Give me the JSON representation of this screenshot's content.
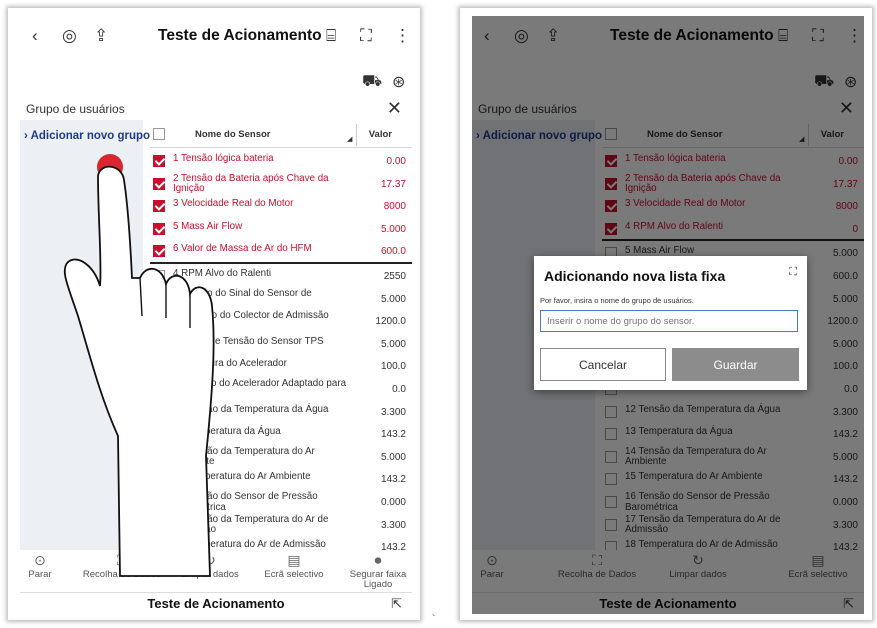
{
  "app": {
    "title": "Teste de Acionamento",
    "footer_title": "Teste de Acionamento"
  },
  "icons": {
    "back": "‹",
    "diag": "◎",
    "upload": "⇪",
    "vci": "⌸",
    "fullscreen": "⛶",
    "more": "⋮",
    "car": "⛟",
    "tool": "⊛",
    "close": "✕",
    "stop": "⊙",
    "capture": "⛶",
    "clear": "↻",
    "screen": "▤",
    "record": "⏺",
    "pin": "⇱"
  },
  "panel": {
    "group_label": "Grupo de usuários",
    "add_group": "› Adicionar novo grupo"
  },
  "table": {
    "col_name": "Nome do Sensor",
    "col_value": "Valor"
  },
  "rows_left": [
    {
      "name": "1 Tensão lógica bateria",
      "value": "0.00",
      "checked": true
    },
    {
      "name": "2 Tensão da Bateria após Chave da Ignição",
      "value": "17.37",
      "checked": true
    },
    {
      "name": "3 Velocidade Real do Motor",
      "value": "8000",
      "checked": true
    },
    {
      "name": "5 Mass Air Flow",
      "value": "5.000",
      "checked": true
    },
    {
      "name": "6 Valor de Massa de Ar do HFM",
      "value": "600.0",
      "checked": true
    },
    {
      "name": "4 RPM Alvo do Ralenti",
      "value": "2550",
      "checked": false
    },
    {
      "name": "7 Tensão do Sinal do Sensor de Pressão",
      "value": "5.000",
      "checked": false
    },
    {
      "name": "8 Pressão do Colector de Admissão",
      "value": "1200.0",
      "checked": false
    },
    {
      "name": "9 Saída de Tensão do Sensor TPS",
      "value": "5.000",
      "checked": false
    },
    {
      "name": "10 Abertura do Acelerador",
      "value": "100.0",
      "checked": false
    },
    {
      "name": "11 Ângulo do Acelerador Adaptado para Ralenti",
      "value": "0.0",
      "checked": false
    },
    {
      "name": "12 Tensão da Temperatura da Água",
      "value": "3.300",
      "checked": false
    },
    {
      "name": "13 Temperatura da Água",
      "value": "143.2",
      "checked": false
    },
    {
      "name": "14 Tensão da Temperatura do Ar Ambiente",
      "value": "5.000",
      "checked": false
    },
    {
      "name": "15 Temperatura do Ar Ambiente",
      "value": "143.2",
      "checked": false
    },
    {
      "name": "16 Tensão do Sensor de Pressão Barométrica",
      "value": "0.000",
      "checked": false
    },
    {
      "name": "17 Tensão da Temperatura do Ar de Admissão",
      "value": "3.300",
      "checked": false
    },
    {
      "name": "18 Temperatura do Ar de Admissão",
      "value": "143.2",
      "checked": false
    }
  ],
  "rows_right": [
    {
      "name": "1 Tensão lógica bateria",
      "value": "0.00",
      "checked": true
    },
    {
      "name": "2 Tensão da Bateria após Chave da Ignição",
      "value": "17.37",
      "checked": true
    },
    {
      "name": "3 Velocidade Real do Motor",
      "value": "8000",
      "checked": true
    },
    {
      "name": "4 RPM Alvo do Ralenti",
      "value": "0",
      "checked": true
    },
    {
      "name": "5 Mass Air Flow",
      "value": "5.000",
      "checked": false
    },
    {
      "name": "",
      "value": "600.0",
      "checked": false
    },
    {
      "name": "",
      "value": "5.000",
      "checked": false
    },
    {
      "name": "",
      "value": "1200.0",
      "checked": false
    },
    {
      "name": "",
      "value": "5.000",
      "checked": false
    },
    {
      "name": "",
      "value": "100.0",
      "checked": false
    },
    {
      "name": "",
      "value": "0.0",
      "checked": false
    },
    {
      "name": "12 Tensão da Temperatura da Água",
      "value": "3.300",
      "checked": false
    },
    {
      "name": "13 Temperatura da Água",
      "value": "143.2",
      "checked": false
    },
    {
      "name": "14 Tensão da Temperatura do Ar Ambiente",
      "value": "5.000",
      "checked": false
    },
    {
      "name": "15 Temperatura do Ar Ambiente",
      "value": "143.2",
      "checked": false
    },
    {
      "name": "16 Tensão do Sensor de Pressão Barométrica",
      "value": "0.000",
      "checked": false
    },
    {
      "name": "17 Tensão da Temperatura do Ar de Admissão",
      "value": "3.300",
      "checked": false
    },
    {
      "name": "18 Temperatura do Ar de Admissão",
      "value": "143.2",
      "checked": false
    }
  ],
  "bottom_bar": [
    {
      "label": "Parar",
      "icon": "stop"
    },
    {
      "label": "Recolha de Dados",
      "icon": "capture"
    },
    {
      "label": "Limpar dados",
      "icon": "clear"
    },
    {
      "label": "Ecrã selectivo",
      "icon": "screen"
    },
    {
      "label": "Segurar faixa Ligado",
      "icon": "record"
    }
  ],
  "dialog": {
    "title": "Adicionando nova lista fixa",
    "subtitle": "Por favor, insira o nome do grupo de usuários.",
    "placeholder": "Inserir o nome do grupo do sensor.",
    "cancel": "Cancelar",
    "save": "Guardar"
  },
  "colors": {
    "accent": "#c8102e",
    "link": "#1f3a8a",
    "sidebar": "#eceff4"
  },
  "stray_mark": "`"
}
